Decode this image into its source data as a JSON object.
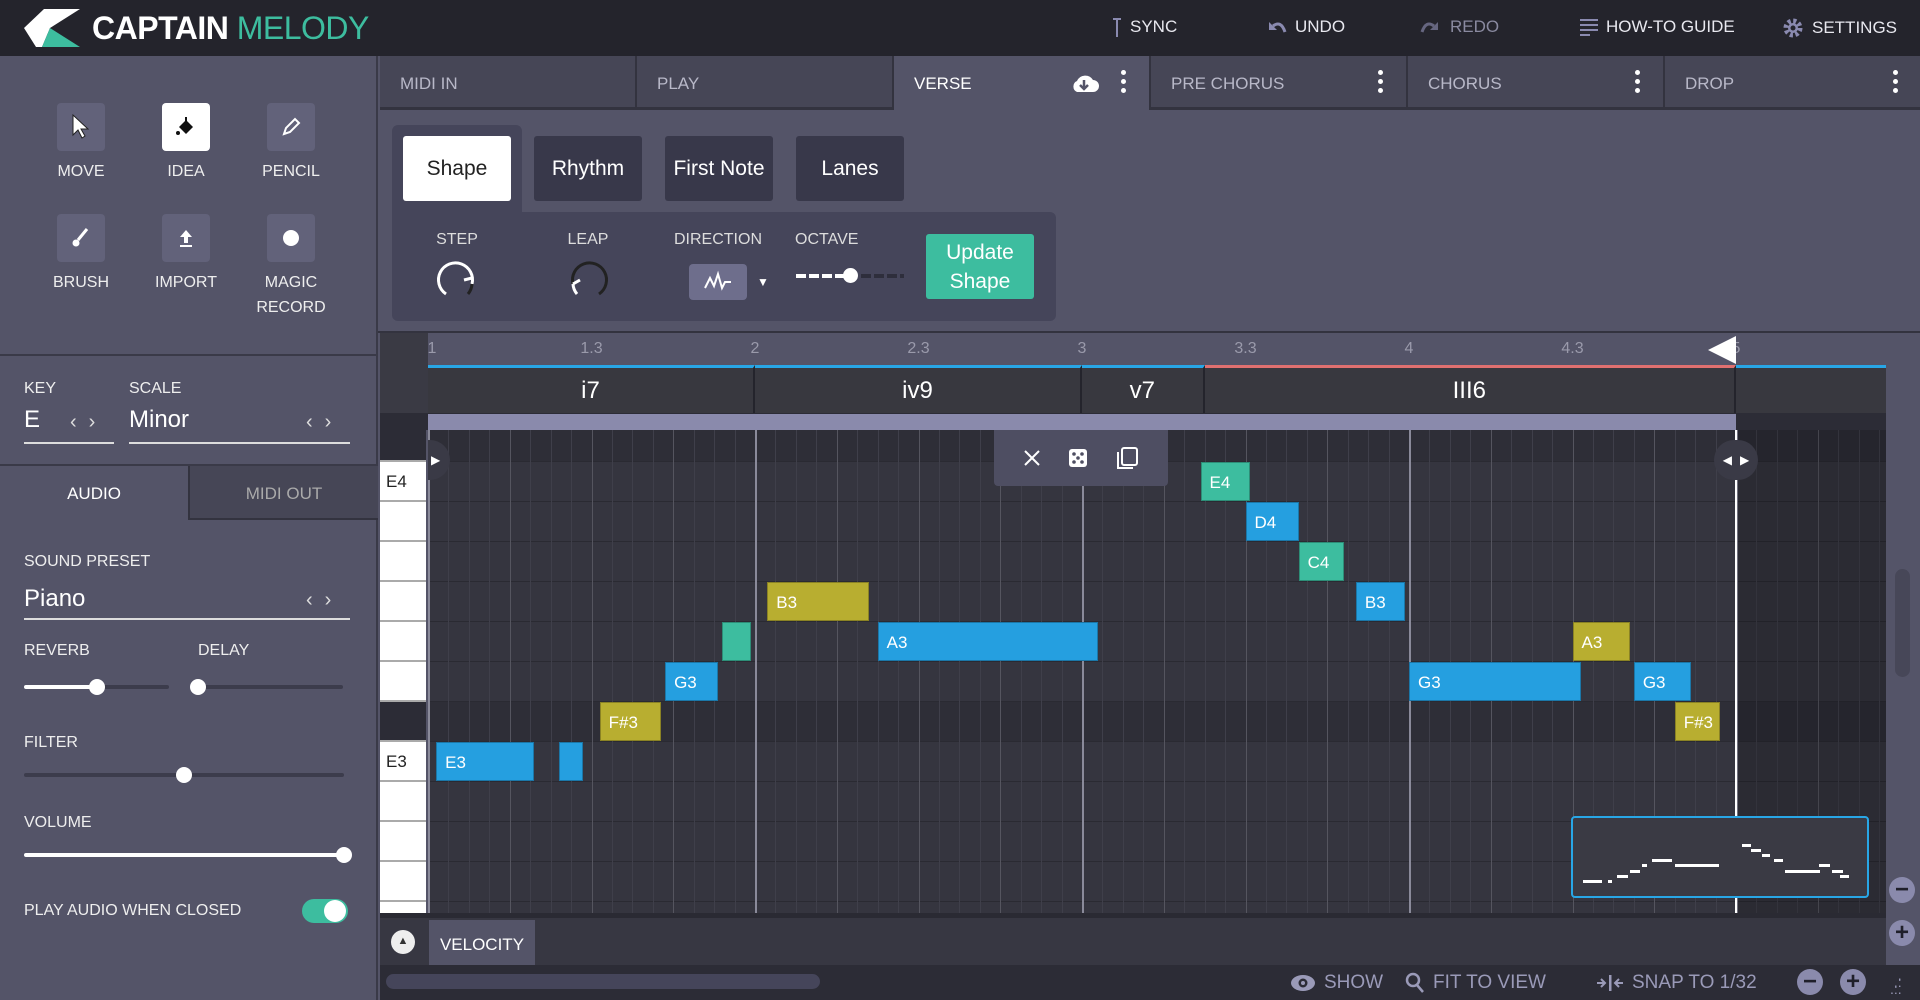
{
  "app": {
    "title_a": "CAPTAIN",
    "title_b": "MELODY",
    "accent": "#3dbd9f"
  },
  "header": {
    "sync": "SYNC",
    "undo": "UNDO",
    "redo": "REDO",
    "guide": "HOW-TO GUIDE",
    "settings": "SETTINGS"
  },
  "tools": [
    {
      "label": "MOVE",
      "icon": "cursor-icon"
    },
    {
      "label": "IDEA",
      "icon": "paint-bucket-icon",
      "active": true
    },
    {
      "label": "PENCIL",
      "icon": "pencil-icon"
    },
    {
      "label": "BRUSH",
      "icon": "brush-icon"
    },
    {
      "label": "IMPORT",
      "icon": "upload-icon"
    },
    {
      "label": "MAGIC",
      "label2": "RECORD",
      "icon": "record-icon"
    }
  ],
  "key": {
    "label": "KEY",
    "value": "E"
  },
  "scale": {
    "label": "SCALE",
    "value": "Minor"
  },
  "output_tabs": {
    "audio": "AUDIO",
    "midi_out": "MIDI  OUT",
    "active": "audio"
  },
  "sound_preset": {
    "label": "SOUND PRESET",
    "value": "Piano"
  },
  "reverb": {
    "label": "REVERB",
    "value": 0.5
  },
  "delay": {
    "label": "DELAY",
    "value": 0.0
  },
  "filter": {
    "label": "FILTER",
    "value": 0.5
  },
  "volume": {
    "label": "VOLUME",
    "value": 1.0
  },
  "play_audio": {
    "label": "PLAY AUDIO WHEN CLOSED",
    "on": true
  },
  "section_tabs": [
    {
      "label": "MIDI IN"
    },
    {
      "label": "PLAY"
    },
    {
      "label": "VERSE",
      "active": true,
      "menu": true,
      "cloud": true
    },
    {
      "label": "PRE CHORUS",
      "menu": true
    },
    {
      "label": "CHORUS",
      "menu": true
    },
    {
      "label": "DROP",
      "menu": true
    }
  ],
  "shape_tabs": [
    "Shape",
    "Rhythm",
    "First Note",
    "Lanes"
  ],
  "shape_controls": {
    "step": "STEP",
    "leap": "LEAP",
    "direction": "DIRECTION",
    "octave": "OCTAVE",
    "octave_value": 0.5,
    "update_line1": "Update",
    "update_line2": "Shape"
  },
  "ruler": [
    "1",
    "1.3",
    "2",
    "2.3",
    "3",
    "3.3",
    "4",
    "4.3",
    "5"
  ],
  "chords": [
    {
      "name": "i7",
      "start": 0,
      "end": 4,
      "color": "#28a6e6"
    },
    {
      "name": "iv9",
      "start": 4,
      "end": 8,
      "color": "#28a6e6"
    },
    {
      "name": "v7",
      "start": 8,
      "end": 9.5,
      "color": "#28a6e6"
    },
    {
      "name": "III6",
      "start": 9.5,
      "end": 16,
      "color": "#e07070"
    }
  ],
  "keys": {
    "top": "E4",
    "bottom": "E3"
  },
  "note_colors": {
    "blue": "#259fe0",
    "teal": "#3dbd9f",
    "olive": "#b8ae30"
  },
  "notes": [
    {
      "pitch": "E3",
      "label": "E3",
      "start": 0.1,
      "end": 1.3,
      "color": "blue"
    },
    {
      "pitch": "E3",
      "label": "",
      "start": 1.6,
      "end": 1.9,
      "color": "blue"
    },
    {
      "pitch": "F#3",
      "label": "F#3",
      "start": 2.1,
      "end": 2.85,
      "color": "olive"
    },
    {
      "pitch": "G3",
      "label": "G3",
      "start": 2.9,
      "end": 3.55,
      "color": "blue"
    },
    {
      "pitch": "A3",
      "label": "",
      "start": 3.6,
      "end": 3.95,
      "color": "teal"
    },
    {
      "pitch": "B3",
      "label": "B3",
      "start": 4.15,
      "end": 5.4,
      "color": "olive"
    },
    {
      "pitch": "A3",
      "label": "A3",
      "start": 5.5,
      "end": 8.2,
      "color": "blue"
    },
    {
      "pitch": "E4",
      "label": "E4",
      "start": 9.45,
      "end": 10.05,
      "color": "teal"
    },
    {
      "pitch": "D4",
      "label": "D4",
      "start": 10.0,
      "end": 10.65,
      "color": "blue"
    },
    {
      "pitch": "C4",
      "label": "C4",
      "start": 10.65,
      "end": 11.2,
      "color": "teal"
    },
    {
      "pitch": "B3",
      "label": "B3",
      "start": 11.35,
      "end": 11.95,
      "color": "blue"
    },
    {
      "pitch": "G3",
      "label": "G3",
      "start": 12.0,
      "end": 14.1,
      "color": "blue"
    },
    {
      "pitch": "A3",
      "label": "A3",
      "start": 14.0,
      "end": 14.7,
      "color": "olive"
    },
    {
      "pitch": "G3",
      "label": "G3",
      "start": 14.75,
      "end": 15.45,
      "color": "blue"
    },
    {
      "pitch": "F#3",
      "label": "F#3",
      "start": 15.25,
      "end": 15.8,
      "color": "olive"
    }
  ],
  "bottom": {
    "velocity": "VELOCITY",
    "show": "SHOW",
    "fit": "FIT TO VIEW",
    "snap": "SNAP TO 1/32"
  }
}
